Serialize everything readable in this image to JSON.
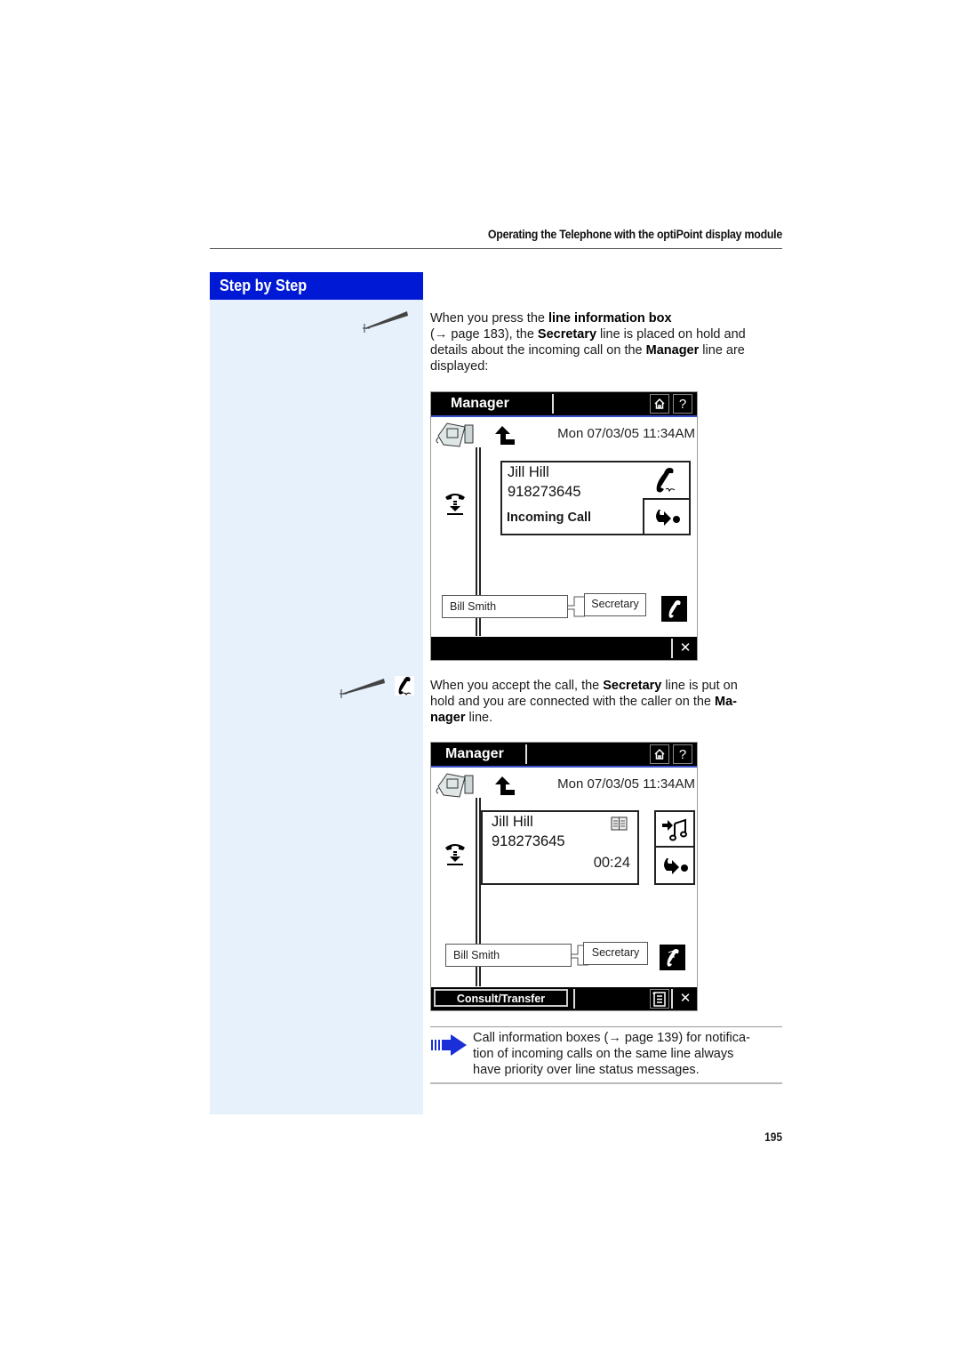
{
  "running_header": "Operating the Telephone with the optiPoint display module",
  "sidebar": {
    "title": "Step by Step"
  },
  "step1": {
    "text_parts": [
      {
        "t": "When you press the ",
        "b": false
      },
      {
        "t": "line information box",
        "b": true
      },
      {
        "t": " (→ page 183), the ",
        "b": false
      },
      {
        "t": "Secretary",
        "b": true
      },
      {
        "t": " line is placed on hold and details about the incoming call on the ",
        "b": false
      },
      {
        "t": "Manager",
        "b": true
      },
      {
        "t": " line are displayed:",
        "b": false
      }
    ],
    "line1": "When you press the ",
    "line1_bold": "line information box",
    "line2_pre": "(→ page 183), the ",
    "line2_bold": "Secretary",
    "line2_post": " line is placed on hold and",
    "line3_pre": "details about the incoming call on the ",
    "line3_bold": "Manager",
    "line3_post": " line are",
    "line4": "displayed:"
  },
  "display1": {
    "title": "Manager",
    "home_icon": "home-icon",
    "help_label": "?",
    "datetime": "Mon 07/03/05 11:34AM",
    "caller_name": "Jill Hill",
    "caller_number": "918273645",
    "status": "Incoming Call",
    "line_keys": [
      "Bill Smith",
      "Secretary"
    ],
    "close_label": "✕"
  },
  "step2": {
    "line1_pre": "When you accept the call, the ",
    "line1_bold": "Secretary",
    "line1_post": " line is put on",
    "line2_pre": "hold and you are connected with the caller on the ",
    "line2_bold": "Ma-",
    "line3_bold": "nager",
    "line3_post": " line."
  },
  "display2": {
    "title": "Manager",
    "help_label": "?",
    "datetime": "Mon 07/03/05 11:34AM",
    "caller_name": "Jill Hill",
    "caller_number": "918273645",
    "call_duration": "00:24",
    "line_keys": [
      "Bill Smith",
      "Secretary"
    ],
    "softkey": "Consult/Transfer",
    "close_label": "✕"
  },
  "note": {
    "line1": "Call information boxes (→ page 139) for notifica-",
    "line2": "tion of incoming calls on the same line always",
    "line3": "have priority over line status messages."
  },
  "page_number": "195",
  "colors": {
    "brand_blue": "#0019d4",
    "sidebar_bg": "#e7f1fc"
  }
}
